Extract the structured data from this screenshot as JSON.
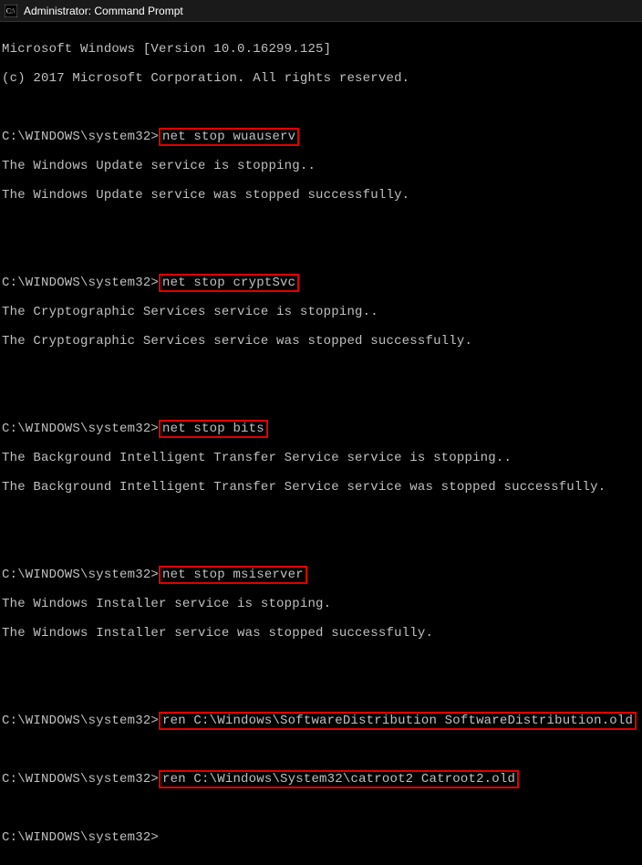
{
  "window": {
    "title": "Administrator: Command Prompt"
  },
  "header": {
    "line1": "Microsoft Windows [Version 10.0.16299.125]",
    "line2": "(c) 2017 Microsoft Corporation. All rights reserved."
  },
  "prompt": "C:\\WINDOWS\\system32>",
  "blocks": [
    {
      "cmd": "net stop wuauserv",
      "out1": "The Windows Update service is stopping..",
      "out2": "The Windows Update service was stopped successfully."
    },
    {
      "cmd": "net stop cryptSvc",
      "out1": "The Cryptographic Services service is stopping..",
      "out2": "The Cryptographic Services service was stopped successfully."
    },
    {
      "cmd": "net stop bits",
      "out1": "The Background Intelligent Transfer Service service is stopping..",
      "out2": "The Background Intelligent Transfer Service service was stopped successfully."
    },
    {
      "cmd": "net stop msiserver",
      "out1": "The Windows Installer service is stopping.",
      "out2": "The Windows Installer service was stopped successfully."
    }
  ],
  "renames": [
    {
      "cmd": "ren C:\\Windows\\SoftwareDistribution SoftwareDistribution.old"
    },
    {
      "cmd": "ren C:\\Windows\\System32\\catroot2 Catroot2.old"
    }
  ]
}
